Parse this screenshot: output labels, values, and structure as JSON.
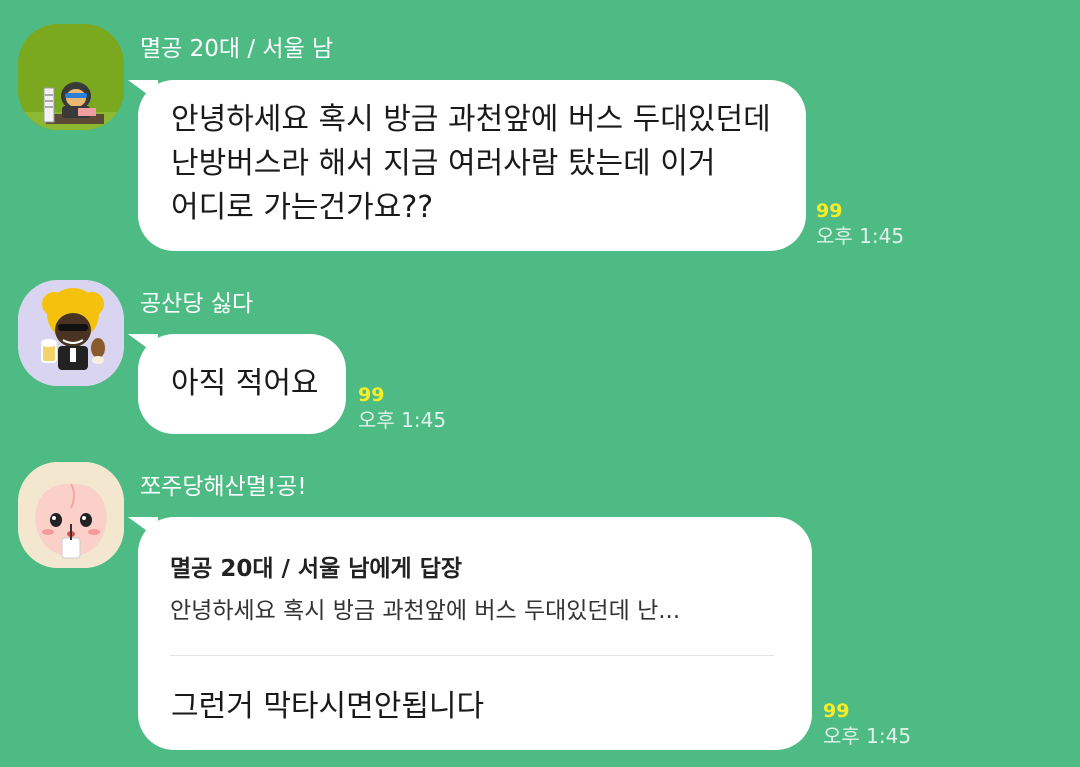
{
  "colors": {
    "background": "#4fbb84",
    "bubble": "#ffffff",
    "unread": "#f6ed28",
    "time": "#dff3e8"
  },
  "messages": [
    {
      "sender": "멸공 20대 / 서울 남",
      "avatar": "ryan-character-at-desk-avatar",
      "text": "안녕하세요 혹시 방금 과천앞에 버스 두대있던데\n난방버스라 해서 지금 여러사람 탔는데 이거\n어디로 가는건가요??",
      "unread": "99",
      "time": "오후 1:45"
    },
    {
      "sender": "공산당 싫다",
      "avatar": "sunglasses-afro-character-avatar",
      "text": "아직 적어요",
      "unread": "99",
      "time": "오후 1:45"
    },
    {
      "sender": "쪼주당해산멸!공!",
      "avatar": "apeach-character-avatar",
      "reply_to": "멸공 20대 / 서울 남에게 답장",
      "quote": "안녕하세요 혹시 방금 과천앞에 버스 두대있던데 난...",
      "text": "그런거 막타시면안됩니다",
      "unread": "99",
      "time": "오후 1:45"
    }
  ]
}
